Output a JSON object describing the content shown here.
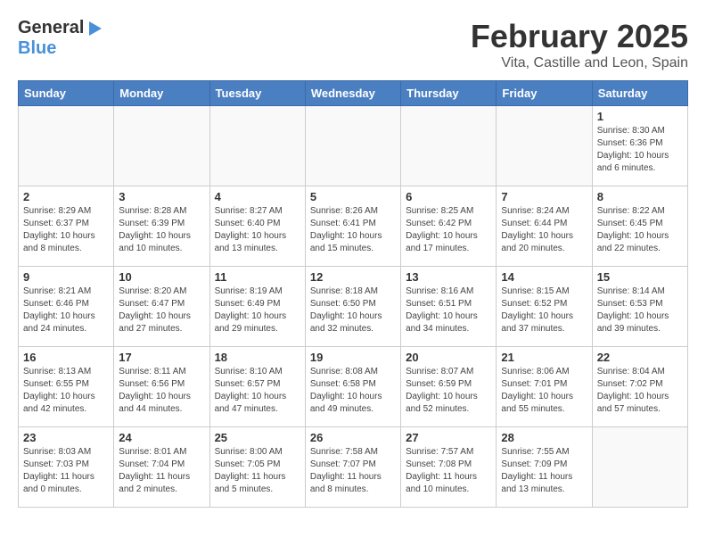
{
  "header": {
    "logo_general": "General",
    "logo_blue": "Blue",
    "title": "February 2025",
    "subtitle": "Vita, Castille and Leon, Spain"
  },
  "days_of_week": [
    "Sunday",
    "Monday",
    "Tuesday",
    "Wednesday",
    "Thursday",
    "Friday",
    "Saturday"
  ],
  "weeks": [
    [
      {
        "day": "",
        "info": ""
      },
      {
        "day": "",
        "info": ""
      },
      {
        "day": "",
        "info": ""
      },
      {
        "day": "",
        "info": ""
      },
      {
        "day": "",
        "info": ""
      },
      {
        "day": "",
        "info": ""
      },
      {
        "day": "1",
        "info": "Sunrise: 8:30 AM\nSunset: 6:36 PM\nDaylight: 10 hours\nand 6 minutes."
      }
    ],
    [
      {
        "day": "2",
        "info": "Sunrise: 8:29 AM\nSunset: 6:37 PM\nDaylight: 10 hours\nand 8 minutes."
      },
      {
        "day": "3",
        "info": "Sunrise: 8:28 AM\nSunset: 6:39 PM\nDaylight: 10 hours\nand 10 minutes."
      },
      {
        "day": "4",
        "info": "Sunrise: 8:27 AM\nSunset: 6:40 PM\nDaylight: 10 hours\nand 13 minutes."
      },
      {
        "day": "5",
        "info": "Sunrise: 8:26 AM\nSunset: 6:41 PM\nDaylight: 10 hours\nand 15 minutes."
      },
      {
        "day": "6",
        "info": "Sunrise: 8:25 AM\nSunset: 6:42 PM\nDaylight: 10 hours\nand 17 minutes."
      },
      {
        "day": "7",
        "info": "Sunrise: 8:24 AM\nSunset: 6:44 PM\nDaylight: 10 hours\nand 20 minutes."
      },
      {
        "day": "8",
        "info": "Sunrise: 8:22 AM\nSunset: 6:45 PM\nDaylight: 10 hours\nand 22 minutes."
      }
    ],
    [
      {
        "day": "9",
        "info": "Sunrise: 8:21 AM\nSunset: 6:46 PM\nDaylight: 10 hours\nand 24 minutes."
      },
      {
        "day": "10",
        "info": "Sunrise: 8:20 AM\nSunset: 6:47 PM\nDaylight: 10 hours\nand 27 minutes."
      },
      {
        "day": "11",
        "info": "Sunrise: 8:19 AM\nSunset: 6:49 PM\nDaylight: 10 hours\nand 29 minutes."
      },
      {
        "day": "12",
        "info": "Sunrise: 8:18 AM\nSunset: 6:50 PM\nDaylight: 10 hours\nand 32 minutes."
      },
      {
        "day": "13",
        "info": "Sunrise: 8:16 AM\nSunset: 6:51 PM\nDaylight: 10 hours\nand 34 minutes."
      },
      {
        "day": "14",
        "info": "Sunrise: 8:15 AM\nSunset: 6:52 PM\nDaylight: 10 hours\nand 37 minutes."
      },
      {
        "day": "15",
        "info": "Sunrise: 8:14 AM\nSunset: 6:53 PM\nDaylight: 10 hours\nand 39 minutes."
      }
    ],
    [
      {
        "day": "16",
        "info": "Sunrise: 8:13 AM\nSunset: 6:55 PM\nDaylight: 10 hours\nand 42 minutes."
      },
      {
        "day": "17",
        "info": "Sunrise: 8:11 AM\nSunset: 6:56 PM\nDaylight: 10 hours\nand 44 minutes."
      },
      {
        "day": "18",
        "info": "Sunrise: 8:10 AM\nSunset: 6:57 PM\nDaylight: 10 hours\nand 47 minutes."
      },
      {
        "day": "19",
        "info": "Sunrise: 8:08 AM\nSunset: 6:58 PM\nDaylight: 10 hours\nand 49 minutes."
      },
      {
        "day": "20",
        "info": "Sunrise: 8:07 AM\nSunset: 6:59 PM\nDaylight: 10 hours\nand 52 minutes."
      },
      {
        "day": "21",
        "info": "Sunrise: 8:06 AM\nSunset: 7:01 PM\nDaylight: 10 hours\nand 55 minutes."
      },
      {
        "day": "22",
        "info": "Sunrise: 8:04 AM\nSunset: 7:02 PM\nDaylight: 10 hours\nand 57 minutes."
      }
    ],
    [
      {
        "day": "23",
        "info": "Sunrise: 8:03 AM\nSunset: 7:03 PM\nDaylight: 11 hours\nand 0 minutes."
      },
      {
        "day": "24",
        "info": "Sunrise: 8:01 AM\nSunset: 7:04 PM\nDaylight: 11 hours\nand 2 minutes."
      },
      {
        "day": "25",
        "info": "Sunrise: 8:00 AM\nSunset: 7:05 PM\nDaylight: 11 hours\nand 5 minutes."
      },
      {
        "day": "26",
        "info": "Sunrise: 7:58 AM\nSunset: 7:07 PM\nDaylight: 11 hours\nand 8 minutes."
      },
      {
        "day": "27",
        "info": "Sunrise: 7:57 AM\nSunset: 7:08 PM\nDaylight: 11 hours\nand 10 minutes."
      },
      {
        "day": "28",
        "info": "Sunrise: 7:55 AM\nSunset: 7:09 PM\nDaylight: 11 hours\nand 13 minutes."
      },
      {
        "day": "",
        "info": ""
      }
    ]
  ]
}
